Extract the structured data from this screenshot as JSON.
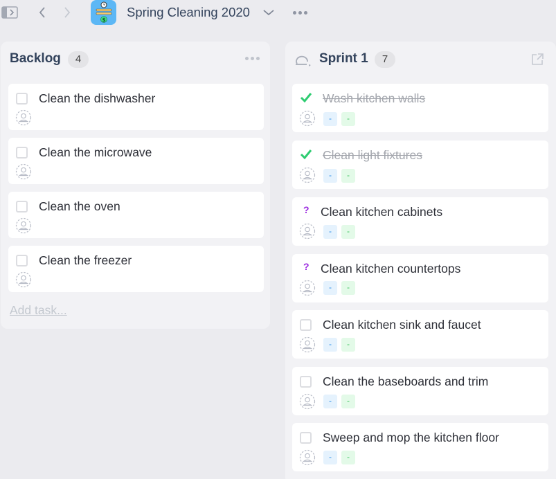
{
  "topbar": {
    "project_title": "Spring Cleaning 2020",
    "icons": {
      "sidebar_toggle": "sidebar-toggle-icon",
      "back": "chevron-left-icon",
      "forward": "chevron-right-icon",
      "app": "pencils-clock-dollar-icon",
      "title_menu": "chevron-down-icon",
      "more": "more-horizontal-icon"
    },
    "back_glyph": "‹",
    "forward_glyph": "›"
  },
  "backlog": {
    "title": "Backlog",
    "count": "4",
    "add_task_label": "Add task...",
    "tasks": [
      {
        "title": "Clean the dishwasher",
        "status": "todo"
      },
      {
        "title": "Clean the microwave",
        "status": "todo"
      },
      {
        "title": "Clean the oven",
        "status": "todo"
      },
      {
        "title": "Clean the freezer",
        "status": "todo"
      }
    ]
  },
  "sprint": {
    "title": "Sprint 1",
    "count": "7",
    "tasks": [
      {
        "title": "Wash kitchen walls",
        "status": "done",
        "tag_blue": "-",
        "tag_green": "-"
      },
      {
        "title": "Clean light fixtures",
        "status": "done",
        "tag_blue": "-",
        "tag_green": "-"
      },
      {
        "title": "Clean kitchen cabinets",
        "status": "unsure",
        "tag_blue": "-",
        "tag_green": "-"
      },
      {
        "title": "Clean kitchen countertops",
        "status": "unsure",
        "tag_blue": "-",
        "tag_green": "-"
      },
      {
        "title": "Clean kitchen sink and faucet",
        "status": "todo",
        "tag_blue": "-",
        "tag_green": "-"
      },
      {
        "title": "Clean the baseboards and trim",
        "status": "todo",
        "tag_blue": "-",
        "tag_green": "-"
      },
      {
        "title": "Sweep and mop the kitchen floor",
        "status": "todo",
        "tag_blue": "-",
        "tag_green": "-"
      }
    ],
    "question_glyph": "?"
  },
  "colors": {
    "background": "#ebebef",
    "column": "#f2f2f5",
    "heading": "#33435c",
    "check_green": "#2ecc71",
    "question_purple": "#9b2be0",
    "tag_blue_bg": "#e5f2fd",
    "tag_green_bg": "#e3fae8",
    "app_icon_bg": "#5cb7f5"
  }
}
